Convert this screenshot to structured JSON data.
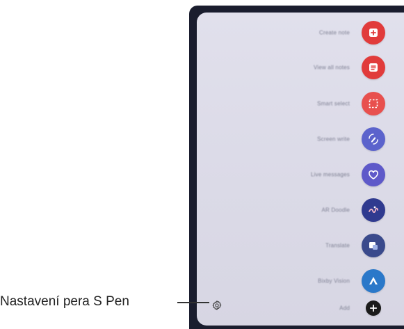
{
  "callout": {
    "settings_label": "Nastavení pera S Pen"
  },
  "menu": {
    "items": [
      {
        "id": "create-note",
        "label": "Create note",
        "icon": "note-plus-icon",
        "color": "#e13b3b"
      },
      {
        "id": "view-all-notes",
        "label": "View all notes",
        "icon": "notes-list-icon",
        "color": "#e13b3b"
      },
      {
        "id": "smart-select",
        "label": "Smart select",
        "icon": "select-frame-icon",
        "color": "#e8504e"
      },
      {
        "id": "screen-write",
        "label": "Screen write",
        "icon": "screen-write-icon",
        "color": "#5b63cc"
      },
      {
        "id": "live-messages",
        "label": "Live messages",
        "icon": "heart-icon",
        "color": "#5e59c9"
      },
      {
        "id": "ar-doodle",
        "label": "AR Doodle",
        "icon": "doodle-icon",
        "color": "#2f3a8f"
      },
      {
        "id": "translate",
        "label": "Translate",
        "icon": "translate-icon",
        "color": "#3a4a8c"
      },
      {
        "id": "bixby-vision",
        "label": "Bixby Vision",
        "icon": "vision-icon",
        "color": "#2a78c9"
      },
      {
        "id": "add",
        "label": "Add",
        "icon": "add-icon",
        "color": "#1b1b1b"
      }
    ]
  },
  "colors": {
    "panel_bg": "#dcdbe8",
    "frame_bg": "#1a1d2e",
    "label_text": "#7d7f92"
  }
}
